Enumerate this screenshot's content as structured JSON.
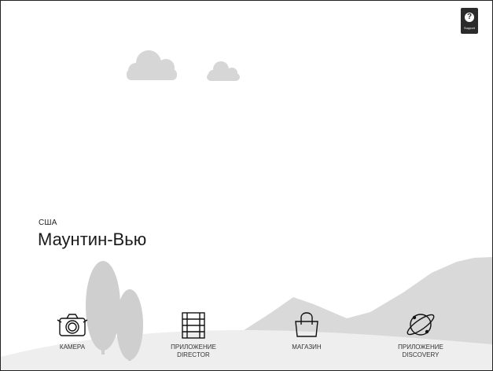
{
  "support": {
    "icon": "help-icon",
    "glyph": "?",
    "label": "Support"
  },
  "location": {
    "country": "США",
    "city": "Маунтин-Вью"
  },
  "tiles": [
    {
      "icon": "camera-icon",
      "line1": "КАМЕРА",
      "line2": ""
    },
    {
      "icon": "film-icon",
      "line1": "ПРИЛОЖЕНИЕ",
      "line2": "DIRECTOR"
    },
    {
      "icon": "shopping-bag-icon",
      "line1": "МАГАЗИН",
      "line2": ""
    },
    {
      "icon": "planet-icon",
      "line1": "ПРИЛОЖЕНИЕ",
      "line2": "DISCOVERY"
    }
  ],
  "colors": {
    "clouds": "#d6d6d6",
    "mountains": "#d9d9d9",
    "trees": "#cfcfcf",
    "ground": "#eeeeee",
    "support_badge": "#2b2b2b"
  }
}
